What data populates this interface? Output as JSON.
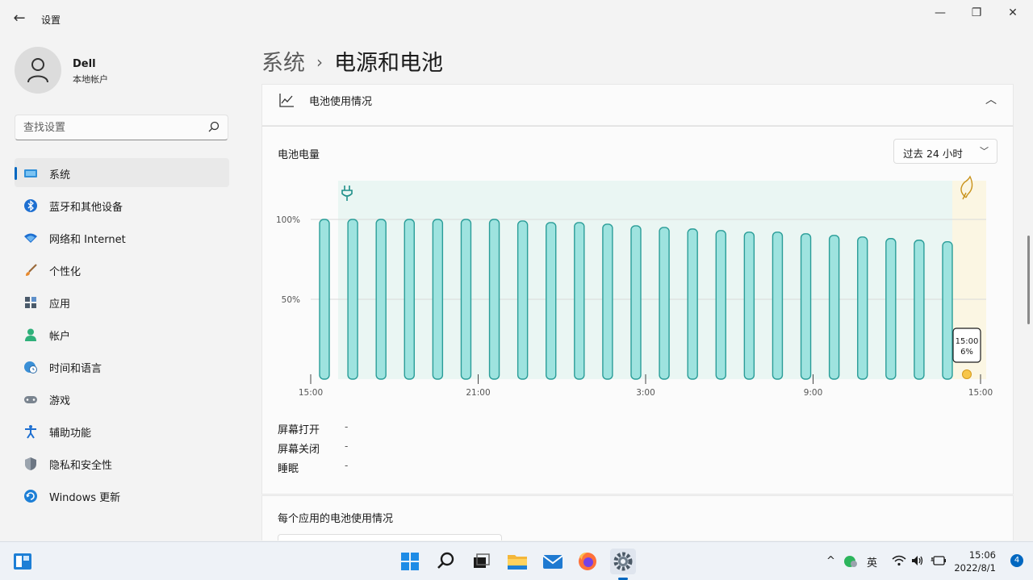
{
  "window": {
    "back_symbol": "←",
    "title": "设置",
    "minimize_symbol": "—",
    "maximize_symbol": "❐",
    "close_symbol": "✕"
  },
  "profile": {
    "name": "Dell",
    "account_type": "本地帐户",
    "avatar_icon": "person-icon"
  },
  "search": {
    "placeholder": "查找设置",
    "icon": "search-icon"
  },
  "sidebar": {
    "items": [
      {
        "label": "系统",
        "icon": "display-icon",
        "active": true
      },
      {
        "label": "蓝牙和其他设备",
        "icon": "bluetooth-icon"
      },
      {
        "label": "网络和 Internet",
        "icon": "wifi-icon"
      },
      {
        "label": "个性化",
        "icon": "paintbrush-icon"
      },
      {
        "label": "应用",
        "icon": "apps-icon"
      },
      {
        "label": "帐户",
        "icon": "account-icon"
      },
      {
        "label": "时间和语言",
        "icon": "globe-clock-icon"
      },
      {
        "label": "游戏",
        "icon": "gamepad-icon"
      },
      {
        "label": "辅助功能",
        "icon": "accessibility-icon"
      },
      {
        "label": "隐私和安全性",
        "icon": "shield-icon"
      },
      {
        "label": "Windows 更新",
        "icon": "update-icon"
      }
    ]
  },
  "page": {
    "breadcrumb_parent": "系统",
    "separator": "›",
    "title": "电源和电池"
  },
  "battery_usage": {
    "header_label": "电池使用情况",
    "header_icon": "line-chart-icon",
    "collapse_icon": "chevron-up-icon",
    "level_title": "电池电量",
    "period": {
      "selected": "过去 24 小时",
      "icon": "chevron-down-icon"
    },
    "stats": [
      {
        "label": "屏幕打开",
        "value": "-"
      },
      {
        "label": "屏幕关闭",
        "value": "-"
      },
      {
        "label": "睡眠",
        "value": "-"
      }
    ],
    "per_app_title": "每个应用的电池使用情况"
  },
  "chart_data": {
    "type": "bar",
    "title": "电池电量",
    "ylim": [
      0,
      100
    ],
    "y_ticks": [
      "50%",
      "100%"
    ],
    "x_tick_labels": [
      "15:00",
      "21:00",
      "3:00",
      "9:00",
      "15:00"
    ],
    "values": [
      100,
      100,
      100,
      100,
      100,
      100,
      100,
      99,
      98,
      98,
      97,
      96,
      95,
      94,
      93,
      92,
      92,
      91,
      90,
      89,
      88,
      87,
      86
    ],
    "current": {
      "time": "15:00",
      "percent": "6%",
      "value": 6
    },
    "plugged_in_icon": "plug-icon",
    "saver_icon": "leaf-icon",
    "colors": {
      "bar": "#9ee3df",
      "bar_stroke": "#2a9d98",
      "charging_bg": "#eaf6f3",
      "saver_bg": "#fbf6e3",
      "marker": "#f7c64a"
    }
  },
  "taskbar": {
    "icons": [
      "widgets-icon",
      "start-icon",
      "search-icon",
      "taskview-icon",
      "file-explorer-icon",
      "mail-icon",
      "firefox-icon",
      "settings-icon"
    ],
    "tray": {
      "chevron": "^",
      "ime": "英",
      "date": "2022/8/1",
      "time": "15:06",
      "notifications": "4"
    }
  }
}
